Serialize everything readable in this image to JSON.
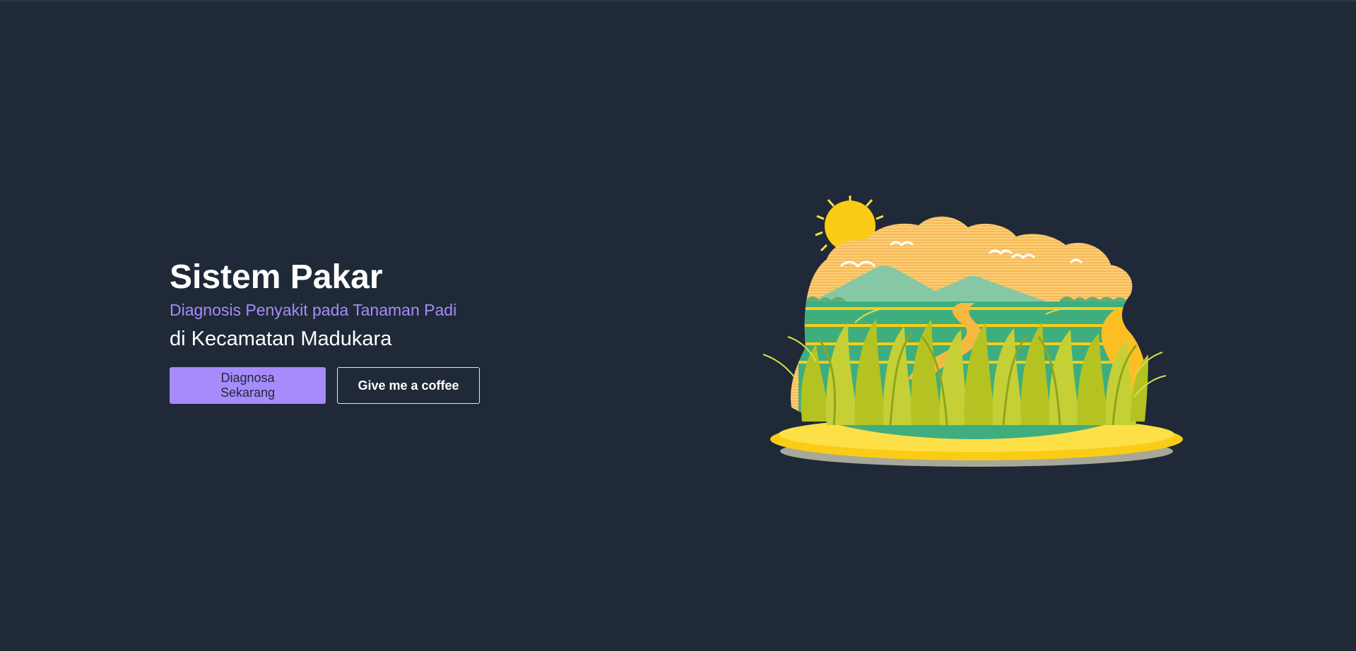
{
  "hero": {
    "title": "Sistem Pakar",
    "subtitle": "Diagnosis Penyakit pada Tanaman Padi",
    "location": "di Kecamatan Madukara"
  },
  "actions": {
    "primary_label": "Diagnosa Sekarang",
    "secondary_label": "Give me a coffee"
  },
  "colors": {
    "background": "#1f2937",
    "accent": "#a78bfa",
    "text": "#ffffff"
  },
  "illustration": {
    "icon": "rice-field-landscape-illustration"
  }
}
